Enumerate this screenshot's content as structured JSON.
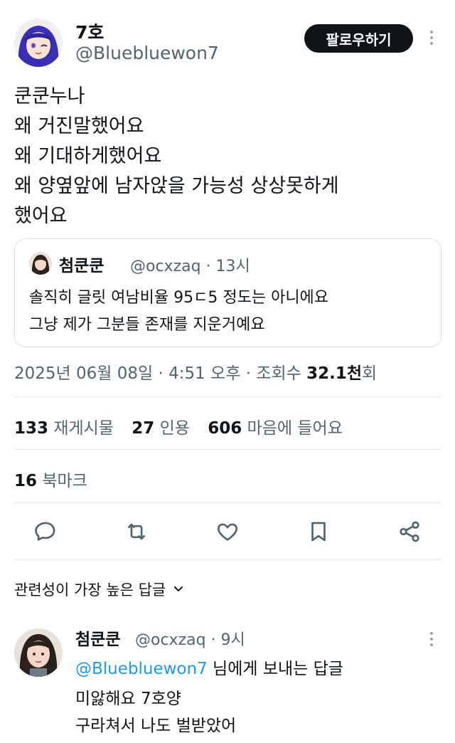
{
  "tweet": {
    "author_name": "7호",
    "author_handle": "@Bluebluewon7",
    "follow_label": "팔로우하기",
    "lines": [
      "쿤쿤누나",
      "왜 거진말했어요",
      "왜 기대하게했어요",
      "왜 양옆앞에 남자앉을 가능성 상상못하게",
      "했어요"
    ],
    "timestamp_prefix": "2025년 06월 08일 · 4:51 오후 · 조회수 ",
    "views_count": "32.1천",
    "views_suffix": "회"
  },
  "quote": {
    "name": "첨쿤쿤",
    "meta": "@ocxzaq · 13시",
    "lines": [
      "솔직히 글릿 여남비율 95ㄷ5 정도는 아니에요",
      "그냥 제가 그분들 존재를 지운거예요"
    ]
  },
  "stats": {
    "reposts_count": "133",
    "reposts_label": "재게시물",
    "quotes_count": "27",
    "quotes_label": "인용",
    "likes_count": "606",
    "likes_label": "마음에 들어요",
    "bookmarks_count": "16",
    "bookmarks_label": "북마크"
  },
  "replies": {
    "sort_label": "관련성이 가장 높은 답글",
    "items": [
      {
        "name": "첨쿤쿤",
        "meta": "@ocxzaq · 9시",
        "reply_to_mention": "@Bluebluewon7",
        "reply_to_suffix": " 님에게 보내는 답글",
        "lines": [
          "미앓해요 7호양",
          "구라쳐서 나도 벌받았어"
        ]
      }
    ]
  },
  "colors": {
    "text": "#0f1419",
    "secondary": "#536471",
    "accent": "#1d9bf0",
    "divider": "#e6e9ec",
    "button": "#0f1419"
  },
  "icons": [
    "more-icon",
    "reply-icon",
    "repost-icon",
    "like-icon",
    "bookmark-icon",
    "share-icon",
    "chevron-down-icon"
  ]
}
